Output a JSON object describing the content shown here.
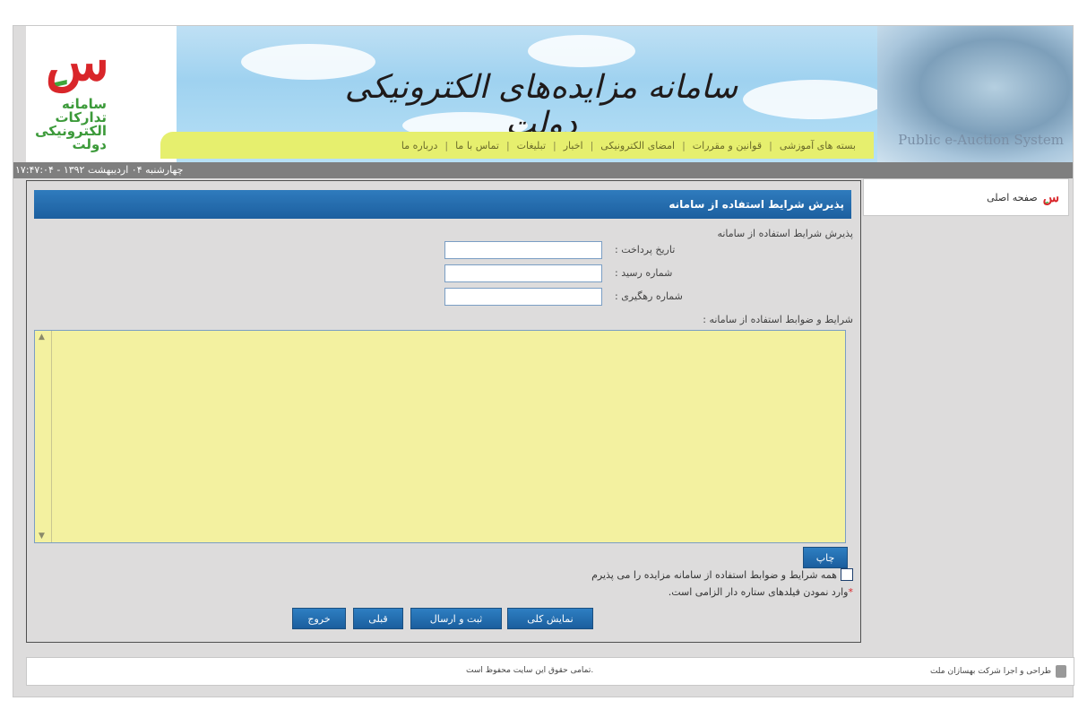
{
  "header": {
    "logo_glyph": "سِ",
    "logo_text": "سامانه تدارکات الکترونیکی دولت",
    "title": "سامانه مزایده‌های الکترونیکی دولت",
    "subtitle_en": "Public e-Auction System",
    "menu": [
      {
        "label": "بسته های آموزشی"
      },
      {
        "label": "قوانین و مقررات"
      },
      {
        "label": "امضای الکترونیکی"
      },
      {
        "label": "اخبار"
      },
      {
        "label": "تبلیغات"
      },
      {
        "label": "تماس با ما"
      },
      {
        "label": "درباره ما"
      }
    ]
  },
  "datebar": {
    "text": "۱۷:۴۷:۰۴ - چهارشنبه ۰۴ اردیبهشت ۱۳۹۲"
  },
  "sidebar": {
    "home_label": "صفحه اصلی",
    "home_icon": "site-logo-icon"
  },
  "main": {
    "title": "پذیرش شرایط استفاده از سامانه",
    "subtitle": "پذیرش شرایط استفاده از سامانه",
    "fields": {
      "payment_date": {
        "label": "تاریخ پرداخت :",
        "value": ""
      },
      "receipt_number": {
        "label": "شماره رسید :",
        "value": ""
      },
      "tracking_number": {
        "label": "شماره رهگیری :",
        "value": ""
      }
    },
    "terms_label": "شرایط و ضوابط استفاده از سامانه :",
    "terms_text": "",
    "print_label": "چاپ",
    "agree_label": "همه شرایط و ضوابط استفاده از سامانه مزایده را می پذیرم",
    "agree_checked": false,
    "required_note": "وارد نمودن فیلدهای ستاره دار الزامی است.",
    "required_star": "*",
    "buttons": {
      "overview": "نمایش کلی",
      "submit": "ثبت و ارسال",
      "previous": "قبلی",
      "exit": "خروج"
    }
  },
  "footer": {
    "copyright": "تمامی حقوق این سایت محفوظ است.",
    "credit": "طراحی و اجرا شرکت بهسازان ملت"
  },
  "colors": {
    "accent": "#1f63a3",
    "menubar": "#e6ef6e",
    "terms_bg": "#f3f1a0"
  }
}
